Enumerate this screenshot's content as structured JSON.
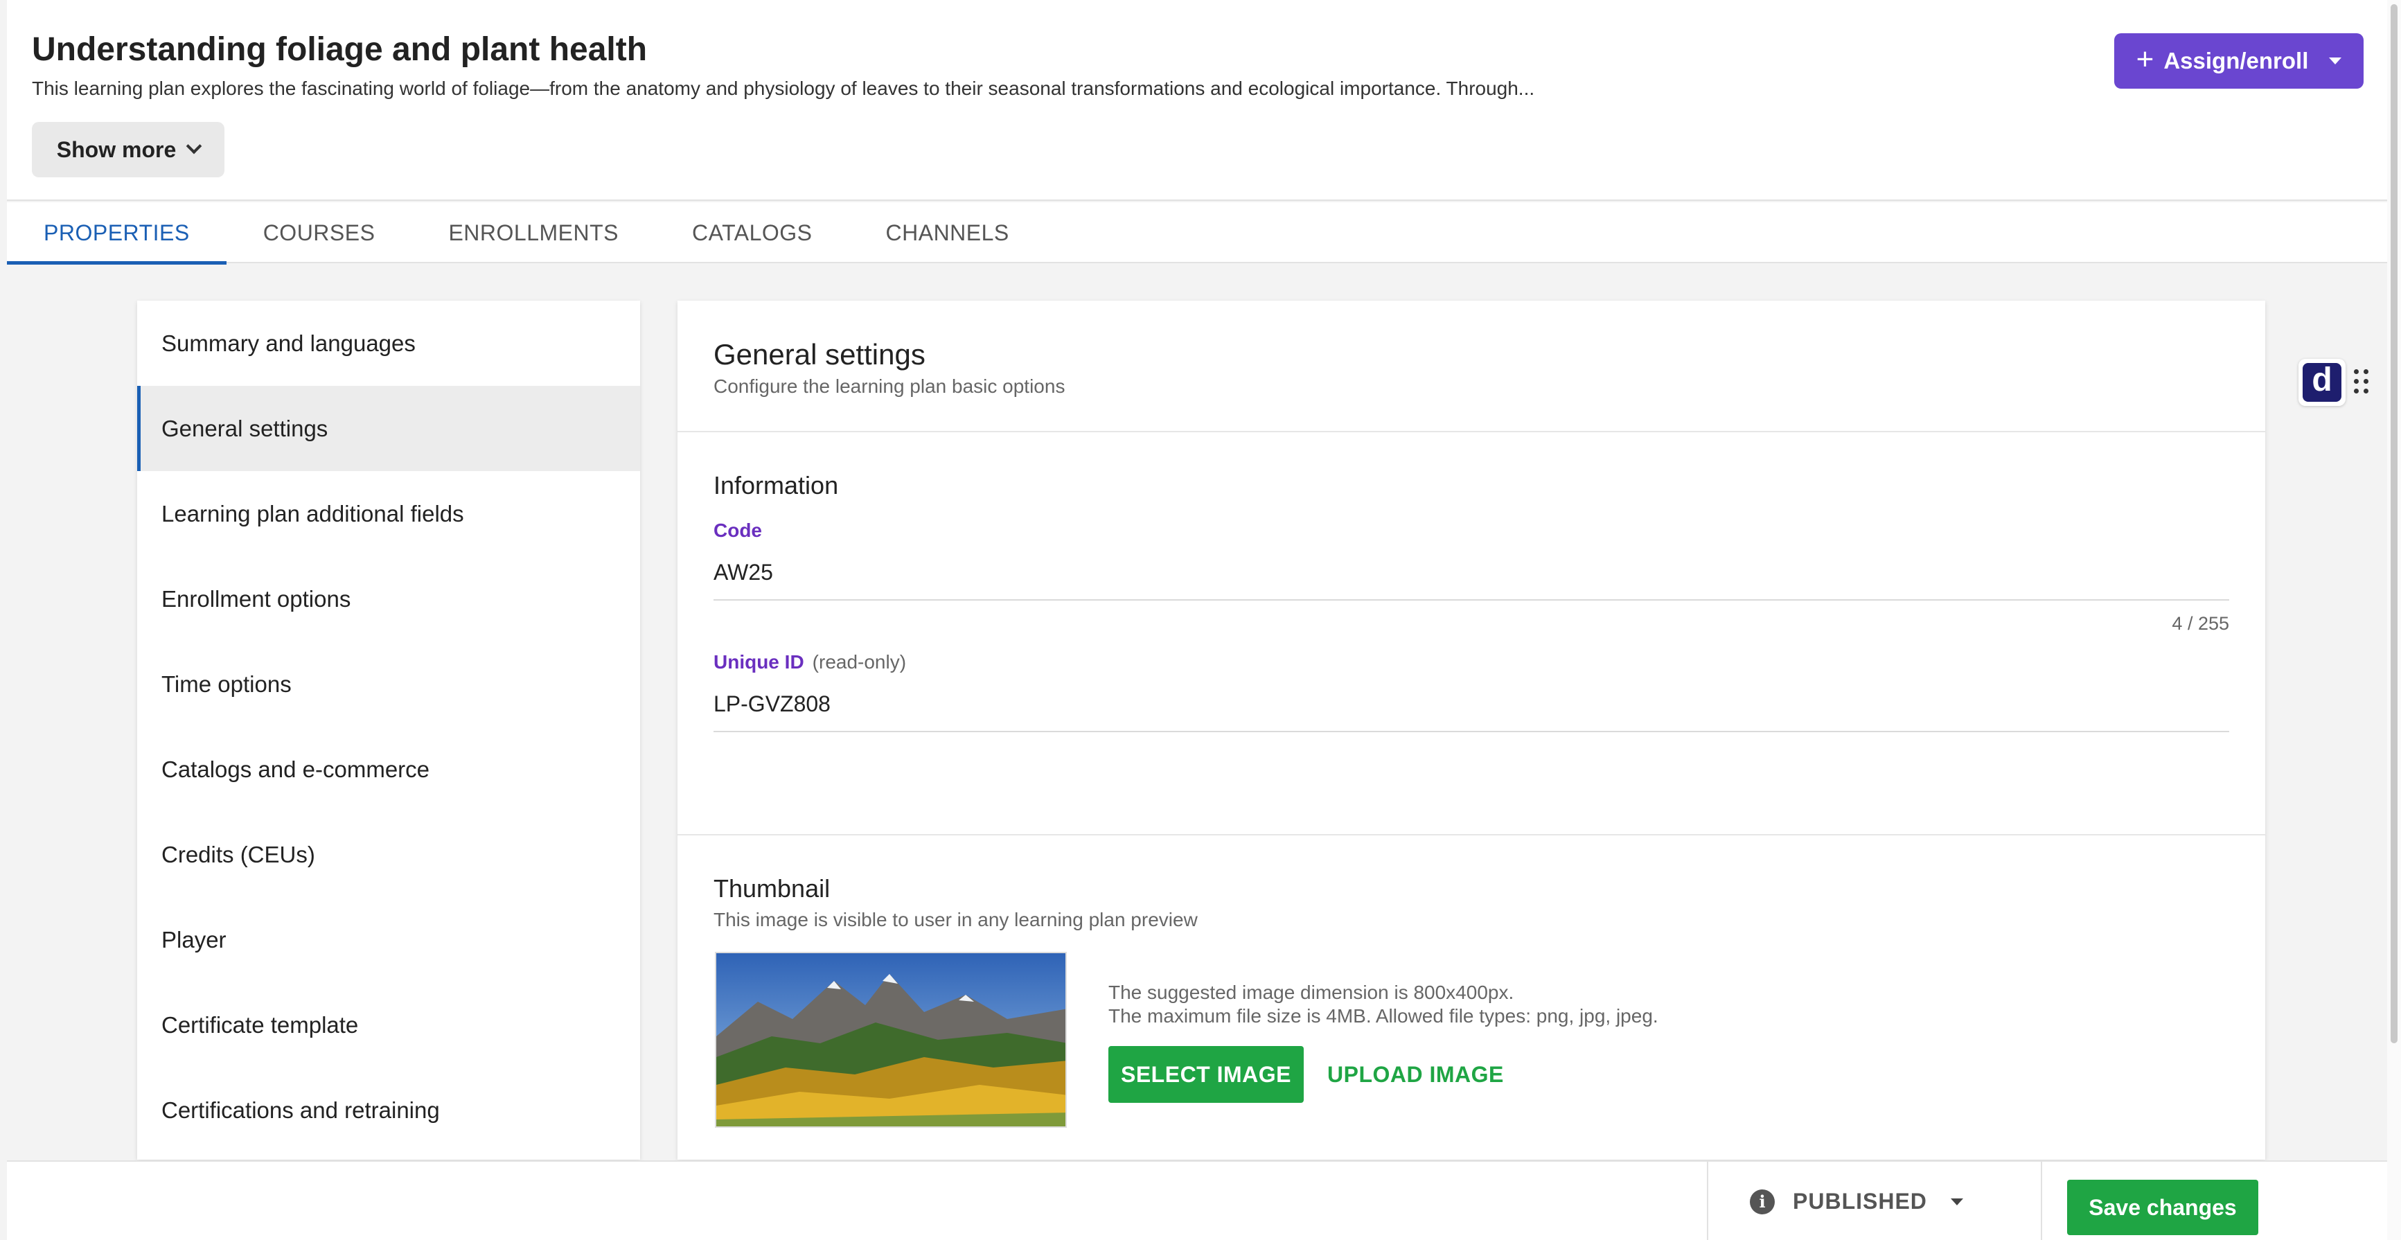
{
  "header": {
    "title": "Understanding foliage and plant health",
    "description": "This learning plan explores the fascinating world of foliage—from the anatomy and physiology of leaves to their seasonal transformations and ecological importance. Through...",
    "show_more_label": "Show more",
    "assign_label": "Assign/enroll"
  },
  "tabs": [
    {
      "label": "PROPERTIES",
      "active": true
    },
    {
      "label": "COURSES",
      "active": false
    },
    {
      "label": "ENROLLMENTS",
      "active": false
    },
    {
      "label": "CATALOGS",
      "active": false
    },
    {
      "label": "CHANNELS",
      "active": false
    }
  ],
  "sidebar": {
    "items": [
      {
        "label": "Summary and languages"
      },
      {
        "label": "General settings",
        "active": true
      },
      {
        "label": "Learning plan additional fields"
      },
      {
        "label": "Enrollment options"
      },
      {
        "label": "Time options"
      },
      {
        "label": "Catalogs and e-commerce"
      },
      {
        "label": "Credits (CEUs)"
      },
      {
        "label": "Player"
      },
      {
        "label": "Certificate template"
      },
      {
        "label": "Certifications and retraining"
      }
    ]
  },
  "main": {
    "title": "General settings",
    "subtitle": "Configure the learning plan basic options",
    "information": {
      "heading": "Information",
      "code_label": "Code",
      "code_value": "AW25",
      "code_counter": "4 / 255",
      "uid_label": "Unique ID",
      "uid_note": "(read-only)",
      "uid_value": "LP-GVZ808"
    },
    "thumbnail": {
      "heading": "Thumbnail",
      "subtitle": "This image is visible to user in any learning plan preview",
      "hint_line1": "The suggested image dimension is 800x400px.",
      "hint_line2": "The maximum file size is 4MB. Allowed file types: png, jpg, jpeg.",
      "select_label": "SELECT IMAGE",
      "upload_label": "UPLOAD IMAGE"
    }
  },
  "footer": {
    "status_label": "PUBLISHED",
    "save_label": "Save changes"
  },
  "widget": {
    "letter": "d"
  },
  "colors": {
    "accent_purple": "#6a46d0",
    "tab_blue": "#1a5fb4",
    "success_green": "#1fa544",
    "label_purple": "#6a2fbf"
  }
}
